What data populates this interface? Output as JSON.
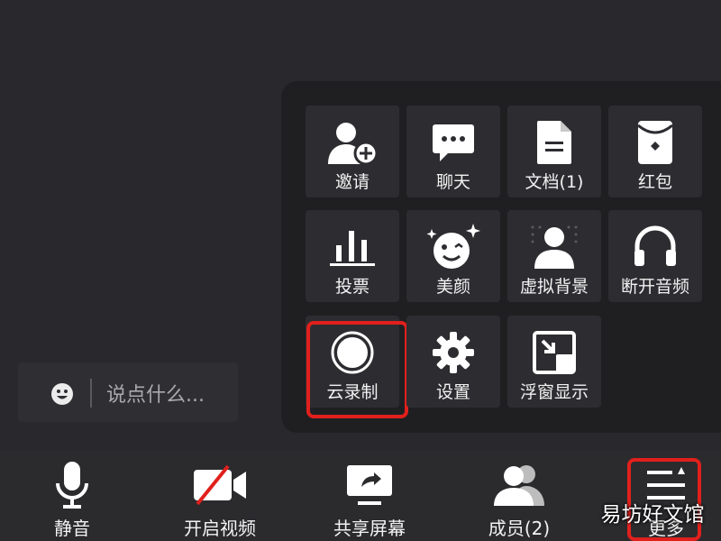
{
  "chat": {
    "placeholder": "说点什么..."
  },
  "more_panel": {
    "rows": [
      [
        {
          "label": "邀请",
          "icon": "invite-icon"
        },
        {
          "label": "聊天",
          "icon": "chat-icon"
        },
        {
          "label": "文档(1)",
          "icon": "document-icon"
        },
        {
          "label": "红包",
          "icon": "red-packet-icon"
        }
      ],
      [
        {
          "label": "投票",
          "icon": "vote-icon"
        },
        {
          "label": "美颜",
          "icon": "beauty-icon"
        },
        {
          "label": "虚拟背景",
          "icon": "virtual-background-icon"
        },
        {
          "label": "断开音频",
          "icon": "headphones-icon"
        }
      ],
      [
        {
          "label": "云录制",
          "icon": "record-icon",
          "highlighted": true
        },
        {
          "label": "设置",
          "icon": "gear-icon"
        },
        {
          "label": "浮窗显示",
          "icon": "floating-window-icon"
        }
      ]
    ]
  },
  "toolbar": {
    "mute": "静音",
    "video": "开启视频",
    "share": "共享屏幕",
    "members": "成员(2)",
    "more": "更多",
    "more_highlighted": true
  },
  "watermark": "易坊好文馆",
  "colors": {
    "highlight": "#e0201c",
    "panel": "#1f1f22",
    "tile": "#2d2d31",
    "background": "#29292d"
  }
}
